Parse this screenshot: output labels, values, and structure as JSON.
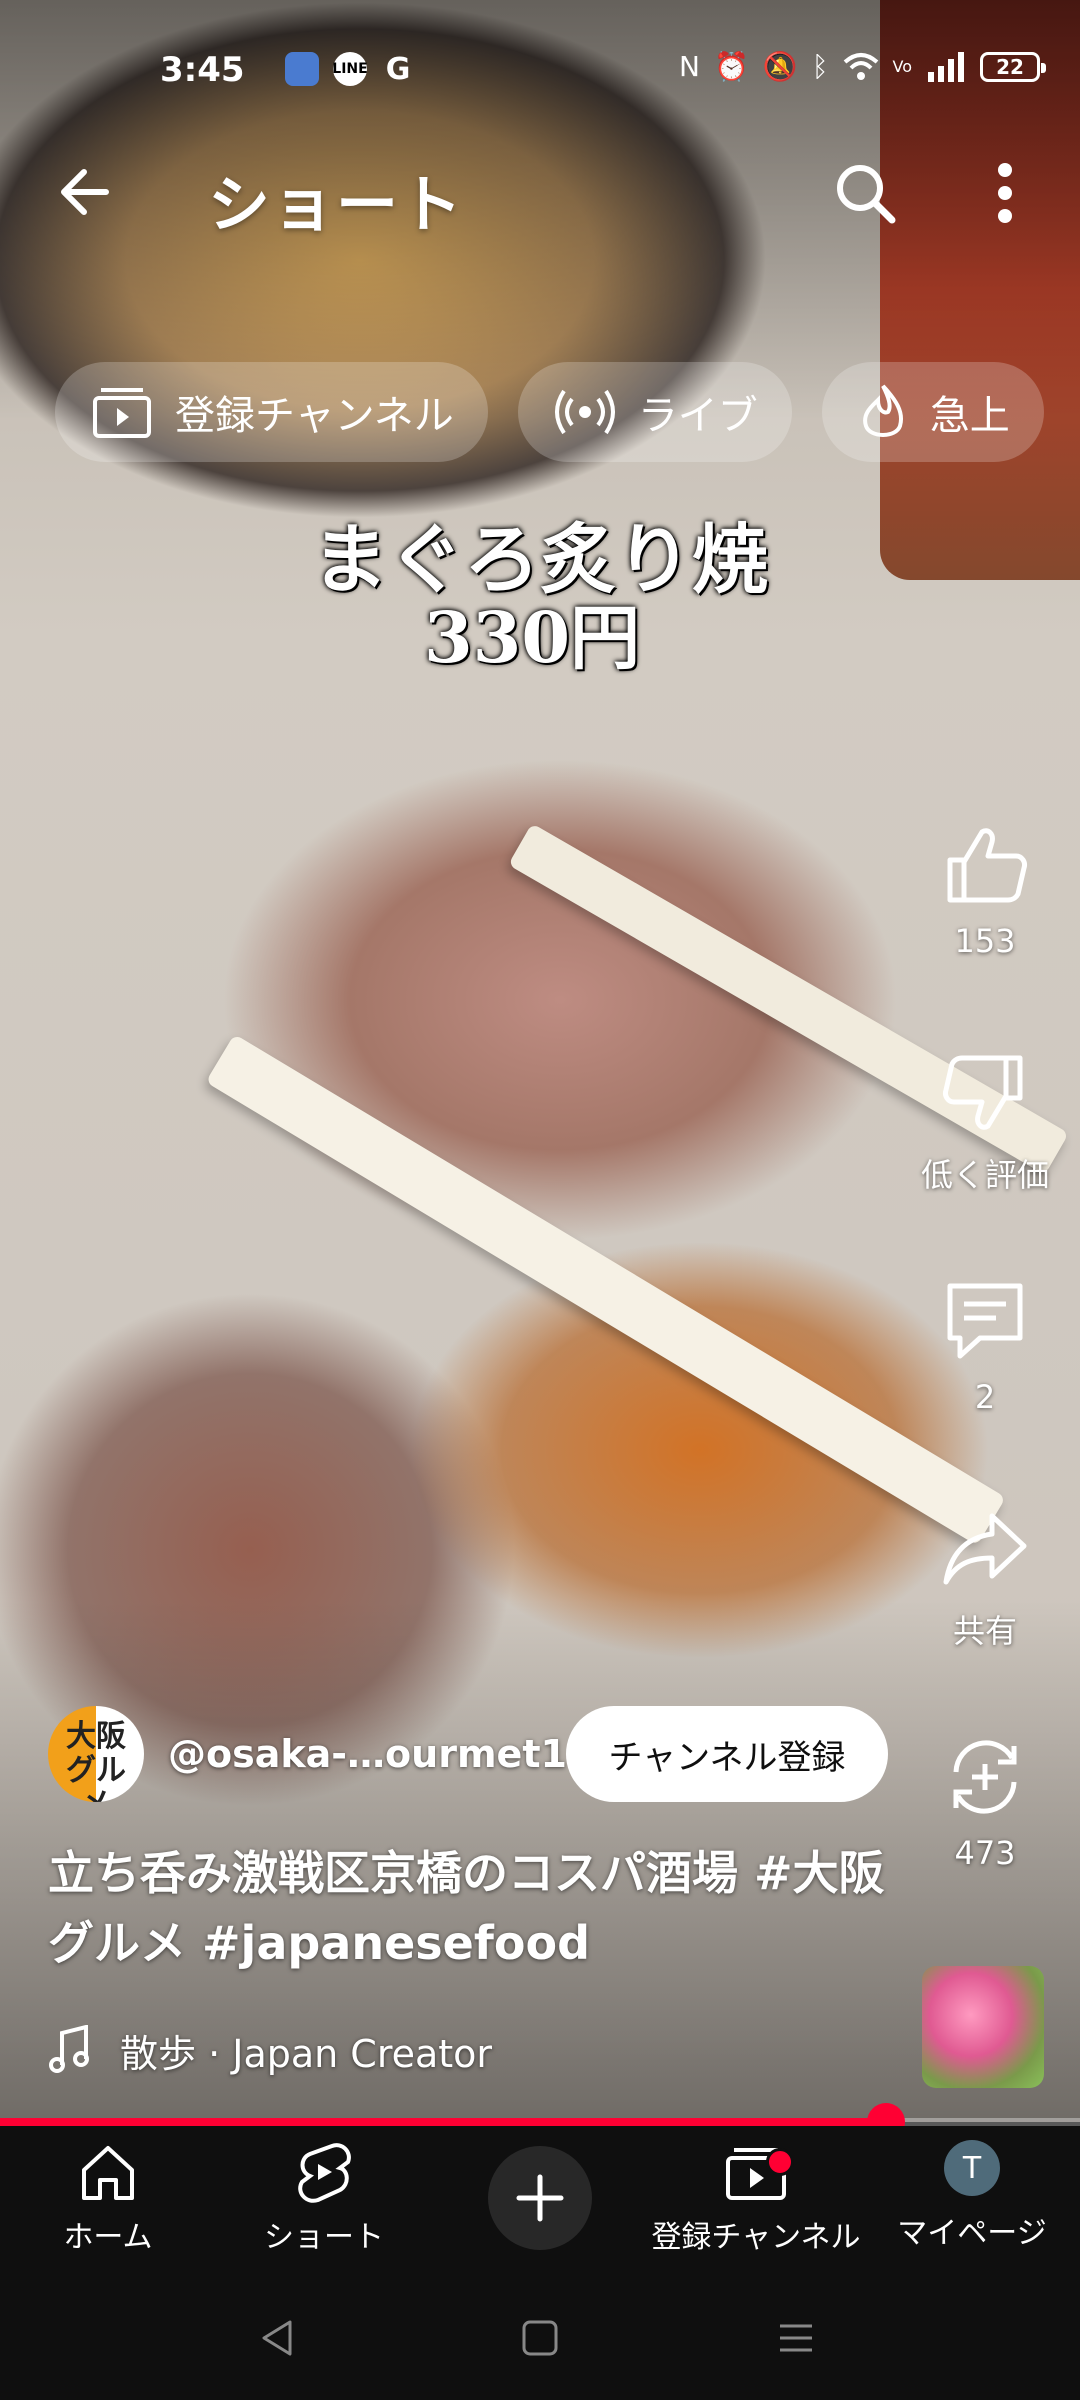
{
  "status_bar": {
    "time": "3:45",
    "notification_icons": [
      "app-icon",
      "line-icon",
      "google-icon"
    ],
    "line_label": "LINE",
    "google_label": "G",
    "system_icons": [
      "nfc-icon",
      "alarm-icon",
      "mute-icon",
      "bluetooth-icon",
      "wifi-icon",
      "volte-icon",
      "signal-icon"
    ],
    "battery": "22"
  },
  "header": {
    "title": "ショート"
  },
  "chips": [
    {
      "label": "登録チャンネル",
      "icon": "subscriptions-icon"
    },
    {
      "label": "ライブ",
      "icon": "live-icon"
    },
    {
      "label": "急上",
      "icon": "trending-icon"
    }
  ],
  "video_overlay": {
    "line1": "まぐろ炙り焼",
    "line2": "330円"
  },
  "actions": {
    "like_count": "153",
    "dislike_label": "低く評価",
    "comment_count": "2",
    "share_label": "共有",
    "remix_count": "473"
  },
  "channel": {
    "avatar_text": "大阪グルメ",
    "avatar_line1": "大阪",
    "avatar_line2": "グルメ",
    "handle": "@osaka-…ourmet1",
    "subscribe_label": "チャンネル登録"
  },
  "caption": "立ち呑み激戦区京橋のコスパ酒場 #大阪グルメ #japanesefood",
  "music": {
    "text": "散歩 · Japan Creator"
  },
  "progress": {
    "fraction": 0.82
  },
  "bottom_nav": [
    {
      "label": "ホーム",
      "icon": "home-icon"
    },
    {
      "label": "ショート",
      "icon": "shorts-icon"
    },
    {
      "label": "",
      "icon": "create-icon"
    },
    {
      "label": "登録チャンネル",
      "icon": "subscriptions-icon"
    },
    {
      "label": "マイページ",
      "icon": "avatar",
      "avatar_letter": "T"
    }
  ],
  "colors": {
    "accent": "#ff0033",
    "nav_bg": "#0f0f0f"
  }
}
